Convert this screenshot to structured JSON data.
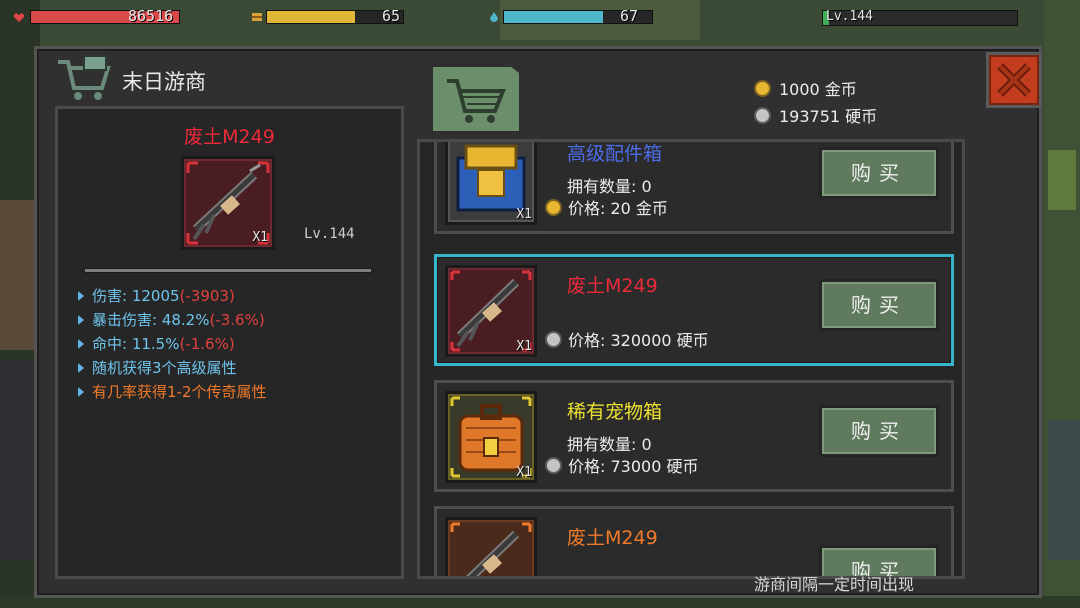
{
  "hud": {
    "health": {
      "value": "86516",
      "fill": 1.0,
      "color": "#d84a4a",
      "icon": "heart-icon"
    },
    "food": {
      "value": "65",
      "fill": 0.65,
      "color": "#e0b636",
      "icon": "food-icon"
    },
    "water": {
      "value": "67",
      "fill": 0.67,
      "color": "#4fb6c9",
      "icon": "water-drop-icon"
    },
    "level": {
      "value": "Lv.144",
      "fill": 0.03,
      "color": "#3fae56"
    }
  },
  "shop": {
    "title": "末日游商",
    "close_icon": "close-x-icon",
    "gold": "1000 金币",
    "coins": "193751 硬币",
    "footer_note": "游商间隔一定时间出现"
  },
  "detail": {
    "name": "废土M249",
    "level": "Lv.144",
    "qty": "X1",
    "stats": [
      {
        "label": "伤害: 12005 ",
        "delta": "(-3903)"
      },
      {
        "label": "暴击伤害: 48.2% ",
        "delta": "(-3.6%)"
      },
      {
        "label": "命中: 11.5% ",
        "delta": "(-1.6%)"
      },
      {
        "label": "随机获得3个高级属性",
        "delta": ""
      },
      {
        "label": "有几率获得1-2个传奇属性",
        "delta": ""
      }
    ]
  },
  "items": [
    {
      "name": "高级配件箱",
      "name_color": "#4d6ce8",
      "own": "拥有数量: 0",
      "price": "价格: 20 金币",
      "currency": "gold",
      "qty": "X1",
      "buy": "购买",
      "icon": "parts-box-icon"
    },
    {
      "name": "废土M249",
      "name_color": "#ee2a3a",
      "own": "",
      "price": "价格: 320000 硬币",
      "currency": "silver",
      "qty": "X1",
      "buy": "购买",
      "icon": "machine-gun-icon",
      "selected": true
    },
    {
      "name": "稀有宠物箱",
      "name_color": "#ece030",
      "own": "拥有数量: 0",
      "price": "价格: 73000 硬币",
      "currency": "silver",
      "qty": "X1",
      "buy": "购买",
      "icon": "pet-box-icon"
    },
    {
      "name": "废土M249",
      "name_color": "#f07a2a",
      "own": "",
      "price": "",
      "currency": "silver",
      "qty": "",
      "buy": "购买",
      "icon": "machine-gun-icon"
    }
  ]
}
